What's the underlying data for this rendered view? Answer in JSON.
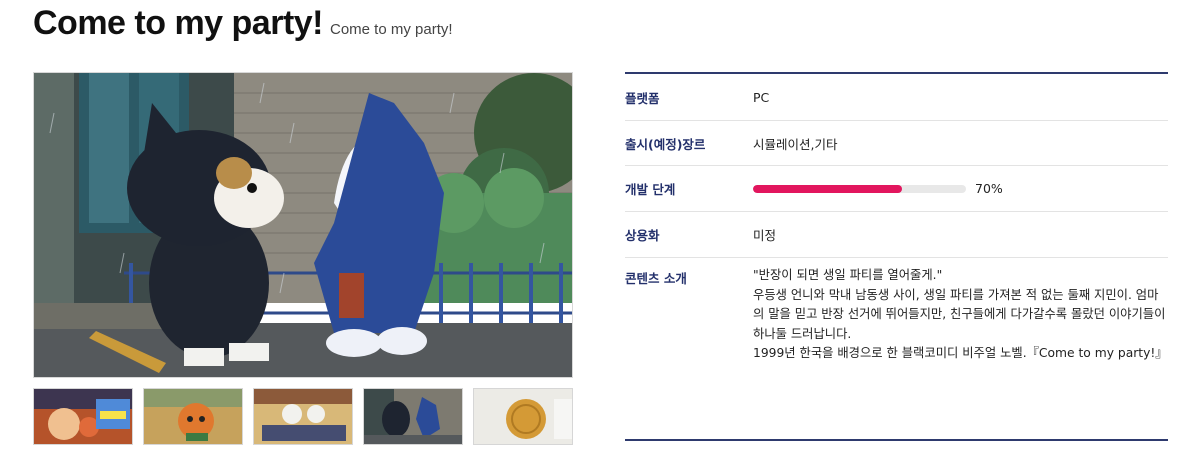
{
  "header": {
    "title": "Come to my party!",
    "subtitle": "Come to my party!"
  },
  "gallery": {
    "main_image_icon": "pixel-art-scene-image",
    "thumbnails": [
      "thumbnail-1",
      "thumbnail-2",
      "thumbnail-3",
      "thumbnail-4",
      "thumbnail-5"
    ]
  },
  "info": {
    "platform_label": "플랫폼",
    "platform_value": "PC",
    "genre_label": "출시(예정)장르",
    "genre_value": "시뮬레이션,기타",
    "stage_label": "개발 단계",
    "stage_progress": 0.7,
    "stage_percent_text": "70%",
    "commercial_label": "상용화",
    "commercial_value": "미정",
    "intro_label": "콘텐츠 소개",
    "intro_lines": [
      "\"반장이 되면 생일 파티를 열어줄게.\"",
      "우등생 언니와 막내 남동생 사이, 생일 파티를 가져본 적 없는 둘째 지민이. 엄마의 말을 믿고 반장 선거에 뛰어들지만, 친구들에게 다가갈수록 몰랐던 이야기들이 하나둘 드러납니다.",
      "1999년 한국을 배경으로 한 블랙코미디 비주얼 노벨.『Come to my party!』"
    ]
  },
  "colors": {
    "accent_navy": "#23306b",
    "progress_fill": "#e2165e",
    "progress_track": "#e8e8e8"
  }
}
